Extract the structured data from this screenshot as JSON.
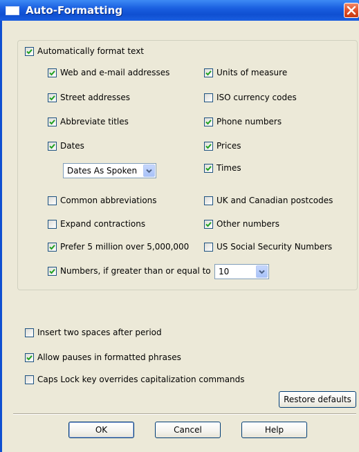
{
  "window": {
    "title": "Auto-Formatting"
  },
  "group": {
    "master_label": "Automatically format text",
    "master_checked": true
  },
  "options_left": [
    {
      "label": "Web and e-mail addresses",
      "checked": true
    },
    {
      "label": "Street addresses",
      "checked": true
    },
    {
      "label": "Abbreviate titles",
      "checked": true
    },
    {
      "label": "Dates",
      "checked": true
    },
    {
      "label": "Common abbreviations",
      "checked": false
    },
    {
      "label": "Expand contractions",
      "checked": false
    },
    {
      "label": "Prefer 5 million over 5,000,000",
      "checked": true
    },
    {
      "label": "Numbers, if greater than or equal to",
      "checked": true
    }
  ],
  "options_right": [
    {
      "label": "Units of measure",
      "checked": true
    },
    {
      "label": "ISO currency codes",
      "checked": false
    },
    {
      "label": "Phone numbers",
      "checked": true
    },
    {
      "label": "Prices",
      "checked": true
    },
    {
      "label": "Times",
      "checked": true
    },
    {
      "label": "UK and Canadian postcodes",
      "checked": false
    },
    {
      "label": "Other numbers",
      "checked": true
    },
    {
      "label": "US Social Security Numbers",
      "checked": false
    }
  ],
  "dates_dropdown": {
    "value": "Dates As Spoken"
  },
  "numbers_dropdown": {
    "value": "10"
  },
  "options_bottom": [
    {
      "label": "Insert two spaces after period",
      "checked": false
    },
    {
      "label": "Allow pauses in formatted phrases",
      "checked": true
    },
    {
      "label": "Caps Lock key overrides capitalization commands",
      "checked": false
    }
  ],
  "buttons": {
    "restore": "Restore defaults",
    "ok": "OK",
    "cancel": "Cancel",
    "help": "Help"
  },
  "colors": {
    "title_bar": "#0f4fd1",
    "dialog_face": "#ece9d8",
    "check_mark": "#21a121",
    "close_button": "#e0502a"
  },
  "icons": {
    "window_icon": "window-icon",
    "close": "close-icon",
    "check": "check-icon",
    "dropdown": "chevron-down-icon"
  }
}
